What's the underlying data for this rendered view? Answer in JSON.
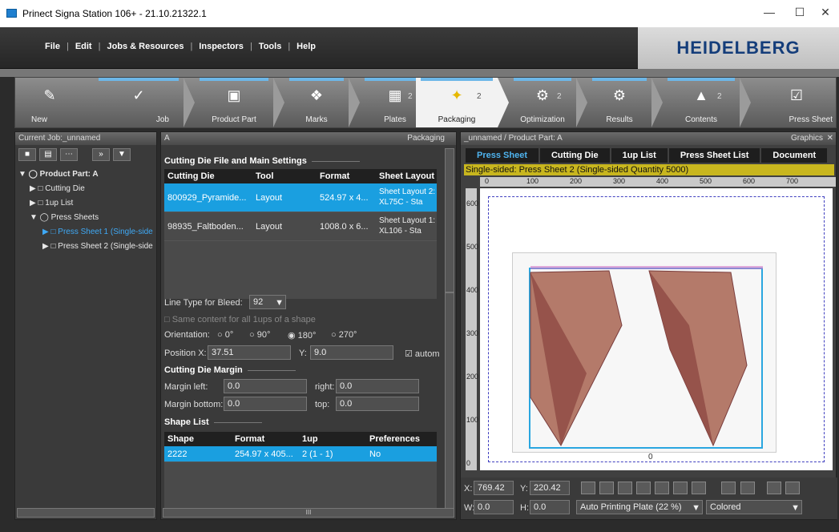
{
  "window": {
    "title": "Prinect Signa Station 106+  - 21.10.21322.1",
    "minimize": "—",
    "maximize": "☐",
    "close": "✕"
  },
  "menu": {
    "file": "File",
    "edit": "Edit",
    "jobs": "Jobs & Resources",
    "inspectors": "Inspectors",
    "tools": "Tools",
    "help": "Help"
  },
  "brand": "HEIDELBERG",
  "toolbar": {
    "new": "New",
    "job": "Job",
    "product_part": "Product Part",
    "marks": "Marks",
    "plates": "Plates",
    "plates_count": "2",
    "packaging": "Packaging",
    "packaging_count": "2",
    "optimization": "Optimization",
    "optimization_count": "2",
    "results": "Results",
    "contents": "Contents",
    "contents_count": "2",
    "press_sheet": "Press Sheet"
  },
  "left": {
    "header": "Current Job:_unnamed",
    "tree": [
      "Product Part: A",
      "Cutting Die",
      "1up List",
      "Press Sheets",
      "Press Sheet 1 (Single-side",
      "Press Sheet 2 (Single-side"
    ]
  },
  "mid": {
    "header_left": "A",
    "header_right": "Packaging",
    "section_cutting": "Cutting Die File and Main Settings",
    "cols": [
      "Cutting Die",
      "Tool",
      "Format",
      "Sheet Layout"
    ],
    "rows": [
      {
        "die": "800929_Pyramide...",
        "tool": "Layout",
        "format": "524.97 x 4...",
        "layout": "Sheet Layout 2: XL75C - Sta"
      },
      {
        "die": "98935_Faltboden...",
        "tool": "Layout",
        "format": "1008.0 x 6...",
        "layout": "Sheet Layout 1: XL106 - Sta"
      }
    ],
    "line_type_label": "Line Type for Bleed:",
    "line_type_value": "92",
    "same_content": "Same content for all 1ups of a shape",
    "orientation_label": "Orientation:",
    "orient": [
      "0°",
      "90°",
      "180°",
      "270°"
    ],
    "posx_label": "Position X:",
    "posx": "37.51",
    "y_label": "Y:",
    "y": "9.0",
    "auto": "autom",
    "section_margin": "Cutting Die Margin",
    "margin_left_label": "Margin left:",
    "margin_left": "0.0",
    "right_label": "right:",
    "right": "0.0",
    "margin_bottom_label": "Margin bottom:",
    "margin_bottom": "0.0",
    "top_label": "top:",
    "top": "0.0",
    "section_shape": "Shape List",
    "shape_cols": [
      "Shape",
      "Format",
      "1up",
      "Preferences"
    ],
    "shape_row": {
      "shape": "2222",
      "format": "254.97 x 405...",
      "oneup": "2 (1 - 1)",
      "pref": "No"
    },
    "scroll_mark": "III"
  },
  "right": {
    "header": "_unnamed / Product Part: A",
    "graphics": "Graphics",
    "tabs": [
      "Press Sheet",
      "Cutting Die",
      "1up List",
      "Press Sheet List",
      "Document"
    ],
    "info": "Single-sided:  Press Sheet 2 (Single-sided Quantity 5000)",
    "ruler_top": [
      "0",
      "100",
      "200",
      "300",
      "400",
      "500",
      "600",
      "700"
    ],
    "ruler_left": [
      "600",
      "500",
      "400",
      "300",
      "200",
      "100",
      "0"
    ],
    "x_label": "X:",
    "x": "769.42",
    "y_label": "Y:",
    "y": "220.42",
    "w_label": "W:",
    "w": "0.0",
    "h_label": "H:",
    "h": "0.0",
    "plate": "Auto Printing Plate (22 %)",
    "color_mode": "Colored",
    "zero_mark": "0"
  }
}
